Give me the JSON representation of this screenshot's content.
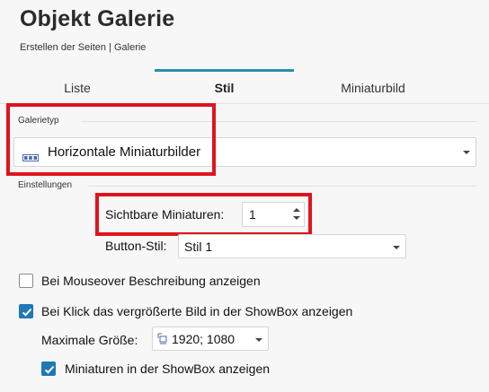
{
  "header": {
    "title": "Objekt Galerie",
    "subtitle": "Erstellen der Seiten | Galerie"
  },
  "tabs": [
    {
      "label": "Liste",
      "active": false
    },
    {
      "label": "Stil",
      "active": true
    },
    {
      "label": "Miniaturbild",
      "active": false
    }
  ],
  "accent_color": "#2a8fb0",
  "highlight_color": "#e0141e",
  "galerietyp": {
    "section_label": "Galerietyp",
    "selected": "Horizontale Miniaturbilder",
    "icon": "horizontal-thumbnails-icon"
  },
  "einstellungen": {
    "section_label": "Einstellungen",
    "sichtbare_label": "Sichtbare Miniaturen:",
    "sichtbare_value": "1",
    "button_stil_label": "Button-Stil:",
    "button_stil_value": "Stil 1"
  },
  "options": {
    "mouseover_label": "Bei Mouseover Beschreibung anzeigen",
    "mouseover_checked": false,
    "klick_label": "Bei Klick das vergrößerte Bild in der ShowBox anzeigen",
    "klick_checked": true,
    "max_size_label": "Maximale Größe:",
    "max_size_value": "1920; 1080",
    "miniaturen_label": "Miniaturen in der ShowBox anzeigen",
    "miniaturen_checked": true
  }
}
